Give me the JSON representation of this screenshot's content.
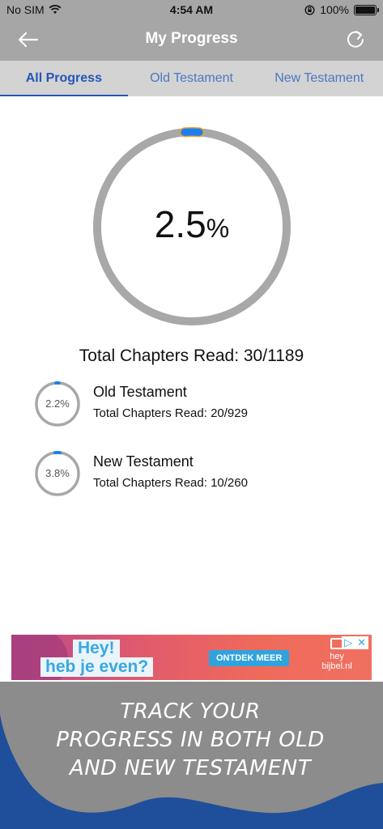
{
  "status_bar": {
    "carrier": "No SIM",
    "time": "4:54 AM",
    "battery": "100%"
  },
  "nav": {
    "title": "My Progress",
    "back_icon": "arrow-left-icon",
    "refresh_icon": "refresh-icon"
  },
  "tabs": [
    {
      "label": "All Progress",
      "active": true
    },
    {
      "label": "Old Testament",
      "active": false
    },
    {
      "label": "New Testament",
      "active": false
    }
  ],
  "overall": {
    "percent_value": 2.5,
    "percent_number": "2.5",
    "percent_unit": "%",
    "total_label": "Total Chapters Read: 30/1189"
  },
  "testaments": [
    {
      "name": "Old Testament",
      "percent_label": "2.2%",
      "percent_value": 2.2,
      "count_label": "Total Chapters Read: 20/929"
    },
    {
      "name": "New Testament",
      "percent_label": "3.8%",
      "percent_value": 3.8,
      "count_label": "Total Chapters Read: 10/260"
    }
  ],
  "ad": {
    "headline": "Hey!",
    "subline": "heb je even?",
    "cta": "ONTDEK MEER",
    "logo_line1": "hey",
    "logo_line2": "bijbel.nl"
  },
  "promo": {
    "line1": "TRACK YOUR",
    "line2": "PROGRESS IN BOTH OLD",
    "line3": "AND NEW TESTAMENT"
  },
  "colors": {
    "bar_gray": "#a6a6a6",
    "tab_bg": "#d3d3d3",
    "accent": "#2455b8",
    "progress_blue": "#1a7ff0",
    "progress_orange": "#f0a030",
    "ring_track": "#a8a8a8",
    "promo_blue": "#1f4f9a"
  }
}
